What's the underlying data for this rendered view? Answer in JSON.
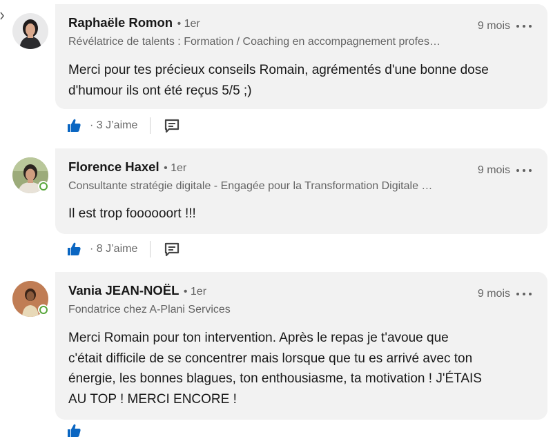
{
  "comments": [
    {
      "name": "Raphaële Romon",
      "degree": "• 1er",
      "headline": "Révélatrice de talents : Formation / Coaching en accompagnement profes…",
      "time": "9 mois",
      "text_lines": [
        "Merci pour tes précieux conseils Romain, agrémentés d'une bonne dose",
        "d'humour ils ont été reçus 5/5   ;)"
      ],
      "likes": "· 3 J’aime",
      "online": false
    },
    {
      "name": "Florence Haxel",
      "degree": "• 1er",
      "headline": "Consultante stratégie digitale - Engagée pour la Transformation Digitale …",
      "time": "9 mois",
      "text_lines": [
        "Il est trop foooooort !!!"
      ],
      "likes": "· 8 J’aime",
      "online": true
    },
    {
      "name": "Vania JEAN-NOËL",
      "degree": "• 1er",
      "headline": "Fondatrice chez A-Plani Services",
      "time": "9 mois",
      "text_lines": [
        "Merci Romain pour ton intervention.  Après le repas je t'avoue que",
        "c'était difficile de se concentrer mais lorsque que tu es arrivé avec ton",
        "énergie, les bonnes blagues, ton enthousiasme,  ta motivation ! J'ÉTAIS",
        "AU TOP ! MERCI ENCORE !"
      ],
      "online": true
    }
  ],
  "colors": {
    "bubble": "#f2f2f2",
    "like_blue": "#0a66c2",
    "online_green": "#57a63a"
  },
  "icons": {
    "like": "like-thumbs-up-icon",
    "reply": "reply-speech-bubble-icon",
    "more": "more-options-icon"
  }
}
